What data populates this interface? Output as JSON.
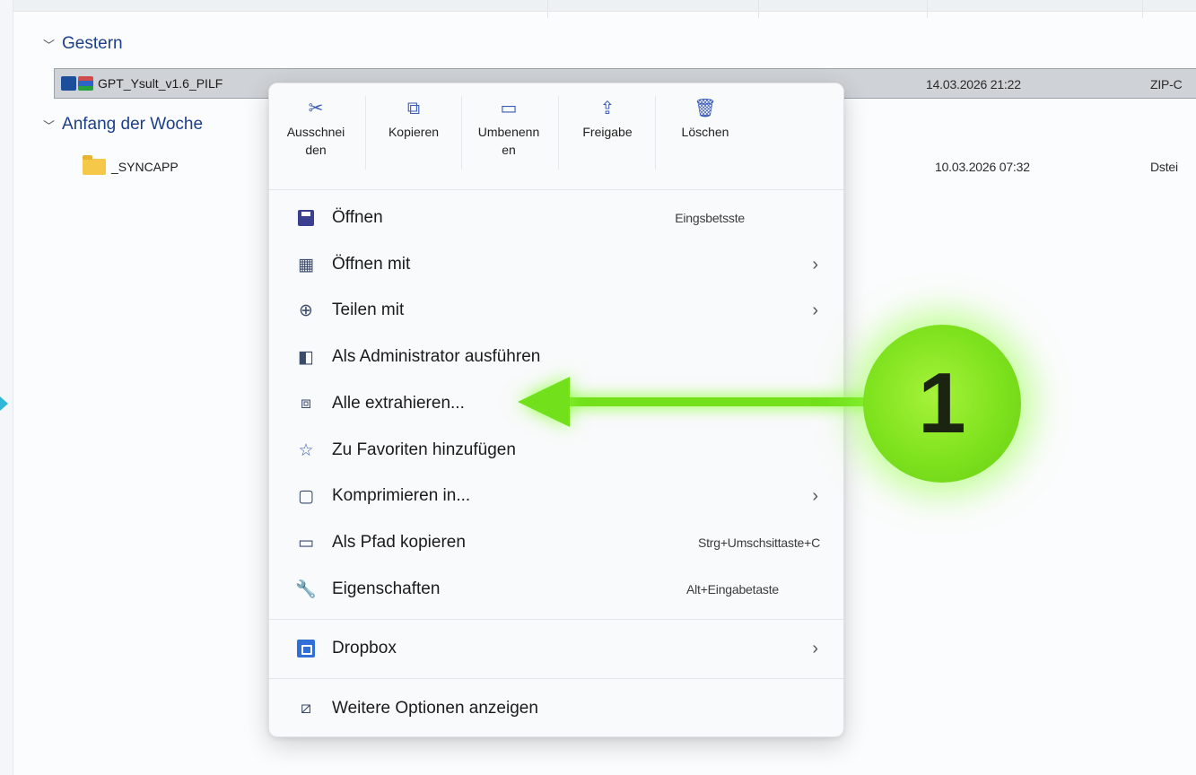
{
  "groups": {
    "yesterday": "Gestern",
    "start_of_week": "Anfang der Woche"
  },
  "files": [
    {
      "name": "GPT_Ysult_v1.6_PILF",
      "date": "14.03.2026 21:22",
      "type": "ZIP-C"
    },
    {
      "name": "_SYNCAPP",
      "date": "10.03.2026 07:32",
      "type": "Dstei"
    }
  ],
  "quick_actions": [
    {
      "icon": "cut-icon",
      "label": "Ausschnei\nden"
    },
    {
      "icon": "copy-icon",
      "label": "Kopieren"
    },
    {
      "icon": "rename-icon",
      "label": "Umbenenn\nen"
    },
    {
      "icon": "share-icon",
      "label": "Freigabe"
    },
    {
      "icon": "delete-icon",
      "label": "Löschen"
    }
  ],
  "menu": {
    "open": {
      "label": "Öffnen",
      "shortcut": "Eingsbetsste"
    },
    "open_with": {
      "label": "Öffnen mit"
    },
    "share_with": {
      "label": "Teilen mit"
    },
    "run_as_admin": {
      "label": "Als Administrator ausführen"
    },
    "extract_all": {
      "label": "Alle extrahieren..."
    },
    "add_favorites": {
      "label": "Zu Favoriten hinzufügen"
    },
    "compress": {
      "label": "Komprimieren in..."
    },
    "copy_path": {
      "label": "Als Pfad kopieren",
      "shortcut": "Strg+Umschsittaste+C"
    },
    "properties": {
      "label": "Eigenschaften",
      "shortcut": "Alt+Eingabetaste"
    },
    "dropbox": {
      "label": "Dropbox"
    },
    "more_options": {
      "label": "Weitere Optionen anzeigen"
    }
  },
  "annotation": {
    "number": "1",
    "color": "#72e01a"
  },
  "colors": {
    "accent": "#3a5bb8",
    "group_header": "#1d3f8a",
    "selection": "#cfd3d7"
  }
}
